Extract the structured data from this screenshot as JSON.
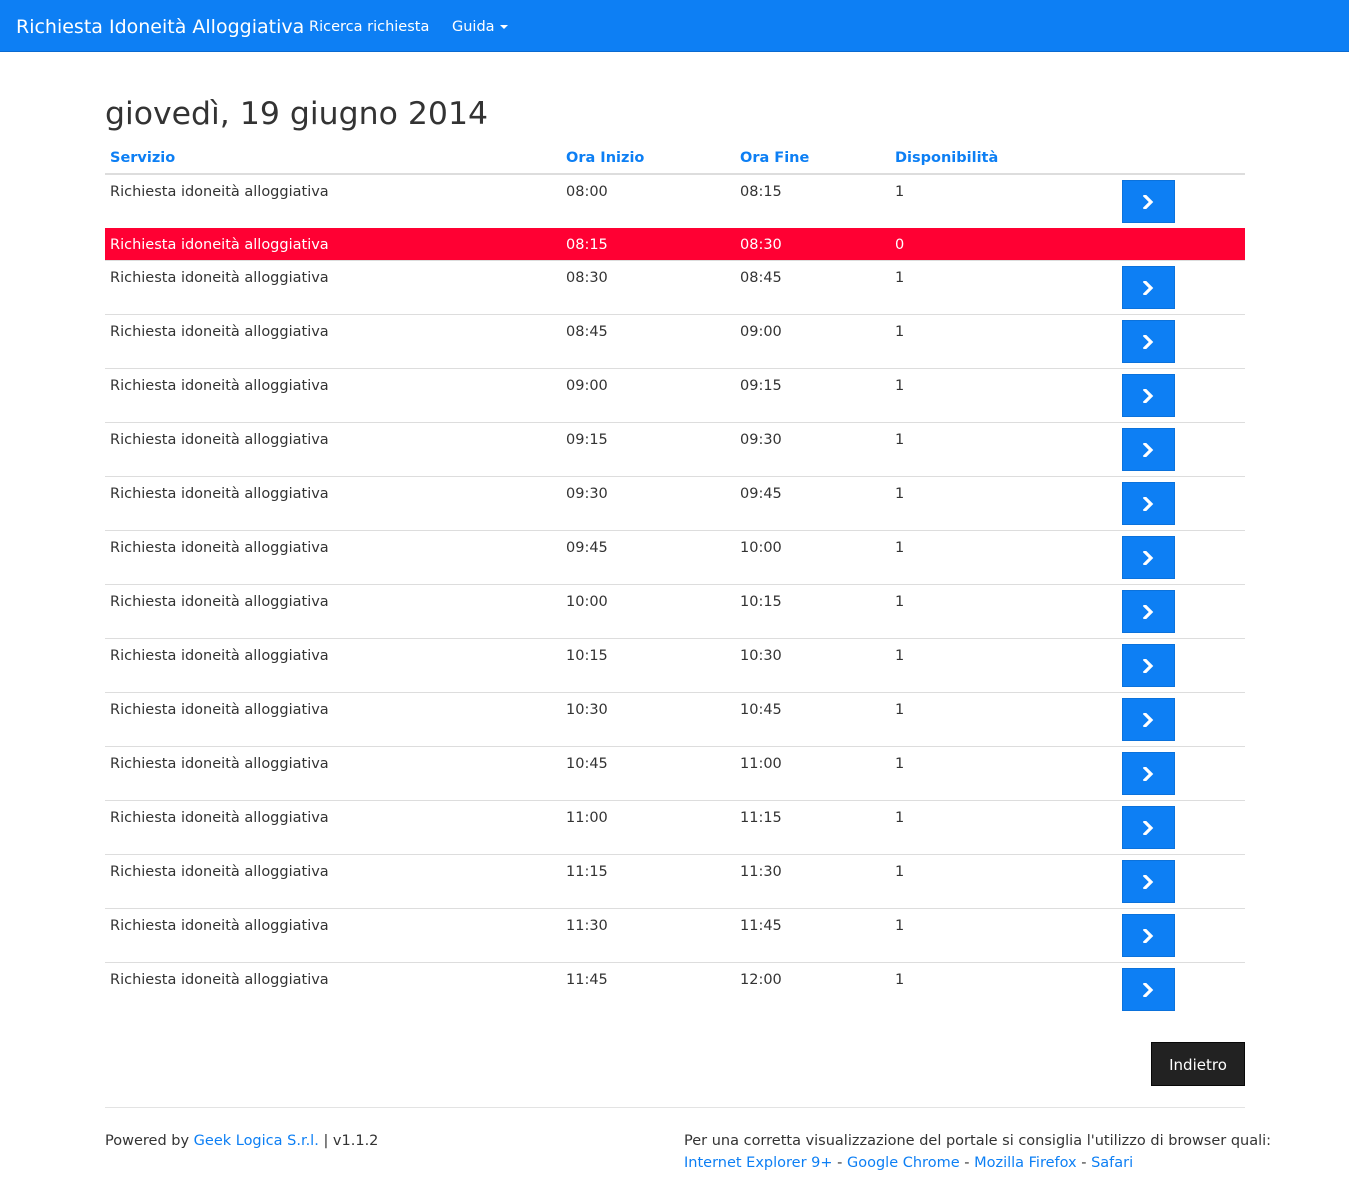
{
  "navbar": {
    "brand": "Richiesta Idoneità Alloggiativa",
    "search_link": "Ricerca richiesta",
    "guide_menu": "Guida"
  },
  "page": {
    "title": "giovedì, 19 giugno 2014"
  },
  "table": {
    "headers": [
      "Servizio",
      "Ora Inizio",
      "Ora Fine",
      "Disponibilità"
    ],
    "rows": [
      {
        "service": "Richiesta idoneità alloggiativa",
        "start": "08:00",
        "end": "08:15",
        "availability": "1"
      },
      {
        "service": "Richiesta idoneità alloggiativa",
        "start": "08:15",
        "end": "08:30",
        "availability": "0"
      },
      {
        "service": "Richiesta idoneità alloggiativa",
        "start": "08:30",
        "end": "08:45",
        "availability": "1"
      },
      {
        "service": "Richiesta idoneità alloggiativa",
        "start": "08:45",
        "end": "09:00",
        "availability": "1"
      },
      {
        "service": "Richiesta idoneità alloggiativa",
        "start": "09:00",
        "end": "09:15",
        "availability": "1"
      },
      {
        "service": "Richiesta idoneità alloggiativa",
        "start": "09:15",
        "end": "09:30",
        "availability": "1"
      },
      {
        "service": "Richiesta idoneità alloggiativa",
        "start": "09:30",
        "end": "09:45",
        "availability": "1"
      },
      {
        "service": "Richiesta idoneità alloggiativa",
        "start": "09:45",
        "end": "10:00",
        "availability": "1"
      },
      {
        "service": "Richiesta idoneità alloggiativa",
        "start": "10:00",
        "end": "10:15",
        "availability": "1"
      },
      {
        "service": "Richiesta idoneità alloggiativa",
        "start": "10:15",
        "end": "10:30",
        "availability": "1"
      },
      {
        "service": "Richiesta idoneità alloggiativa",
        "start": "10:30",
        "end": "10:45",
        "availability": "1"
      },
      {
        "service": "Richiesta idoneità alloggiativa",
        "start": "10:45",
        "end": "11:00",
        "availability": "1"
      },
      {
        "service": "Richiesta idoneità alloggiativa",
        "start": "11:00",
        "end": "11:15",
        "availability": "1"
      },
      {
        "service": "Richiesta idoneità alloggiativa",
        "start": "11:15",
        "end": "11:30",
        "availability": "1"
      },
      {
        "service": "Richiesta idoneità alloggiativa",
        "start": "11:30",
        "end": "11:45",
        "availability": "1"
      },
      {
        "service": "Richiesta idoneità alloggiativa",
        "start": "11:45",
        "end": "12:00",
        "availability": "1"
      }
    ],
    "select_icon": "chevron-right-icon"
  },
  "actions": {
    "back_label": "Indietro"
  },
  "footer": {
    "powered_by": "Powered by",
    "company_link": "Geek Logica S.r.l.",
    "version": "| v1.1.2",
    "browser_note": "Per una corretta visualizzazione del portale si consiglia l'utilizzo di browser quali:",
    "browsers": [
      "Internet Explorer 9+",
      "Google Chrome",
      "Mozilla Firefox",
      "Safari"
    ],
    "separator": " - "
  },
  "colors": {
    "primary": "#0d7ff4",
    "unavailable_row": "#ff0033",
    "back_button": "#222222"
  }
}
